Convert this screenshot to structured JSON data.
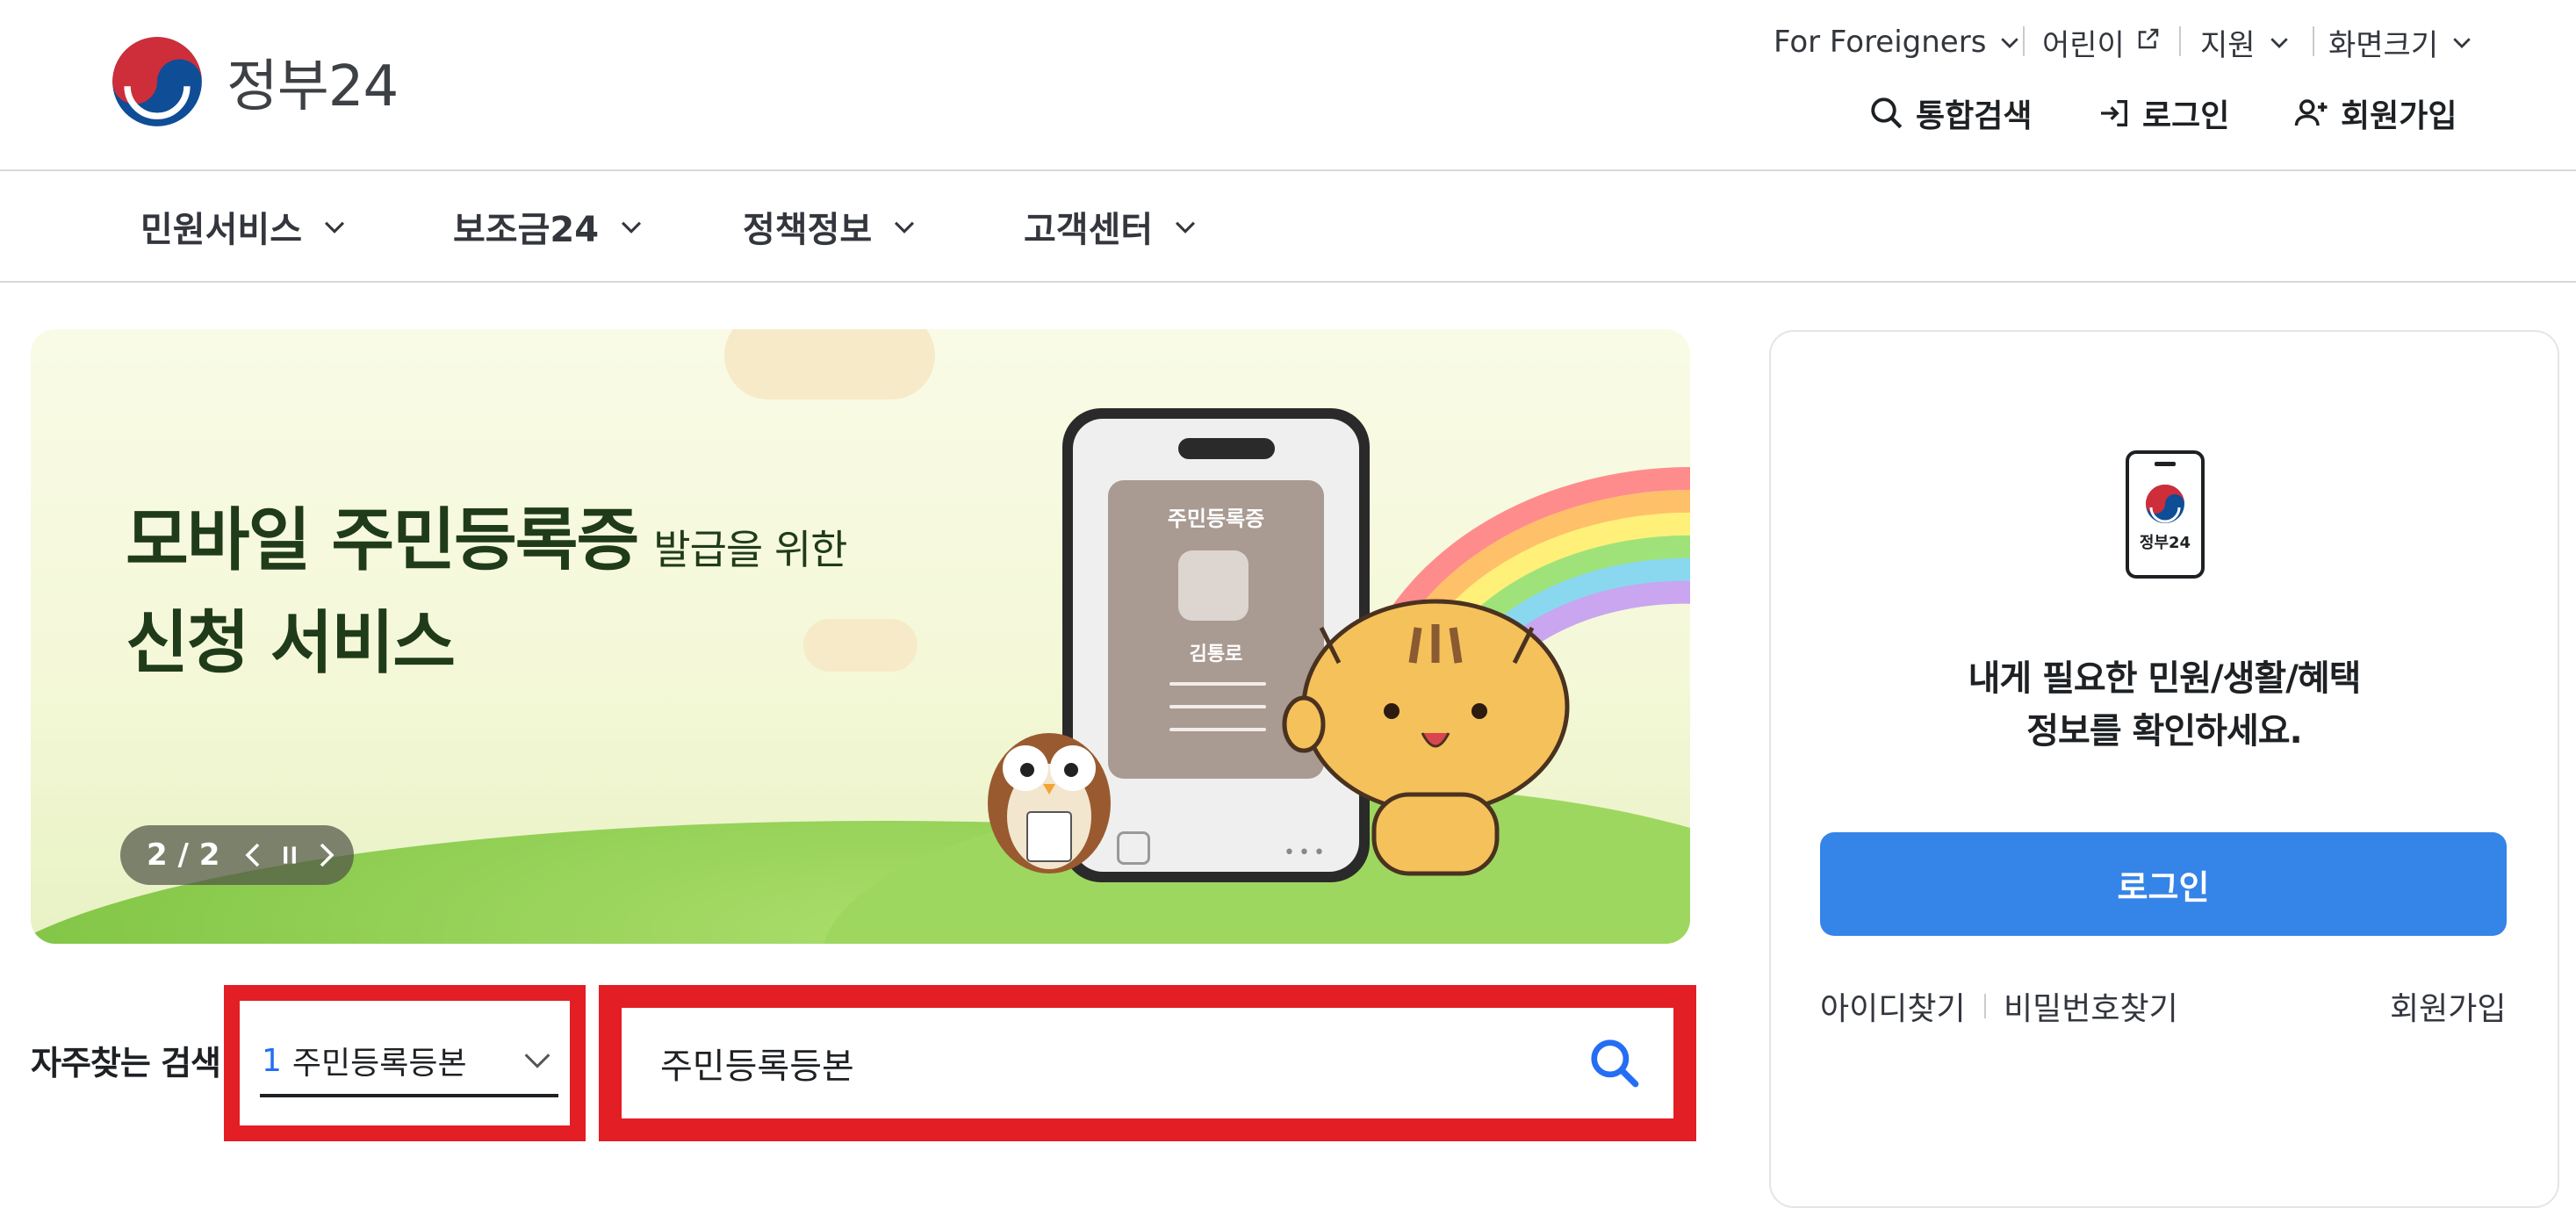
{
  "header": {
    "logo_text": "정부24",
    "util_links": [
      {
        "label": "For Foreigners"
      },
      {
        "label": "어린이"
      },
      {
        "label": "지원"
      },
      {
        "label": "화면크기"
      }
    ],
    "top_buttons": {
      "search": "통합검색",
      "login": "로그인",
      "signup": "회원가입"
    }
  },
  "nav": {
    "items": [
      {
        "label": "민원서비스"
      },
      {
        "label": "보조금24"
      },
      {
        "label": "정책정보"
      },
      {
        "label": "고객센터"
      }
    ]
  },
  "banner": {
    "headline_main": "모바일 주민등록증",
    "headline_small": "발급을 위한",
    "headline_line2": "신청 서비스",
    "card_title": "주민등록증",
    "card_name": "김통로",
    "slide_indicator": "2 / 2"
  },
  "frequent_search": {
    "label": "자주찾는 검색",
    "selected_number": "1",
    "selected_value": "주민등록등본",
    "input_value": "주민등록등본"
  },
  "login_panel": {
    "phone_label": "정부24",
    "message_line1": "내게 필요한 민원/생활/혜택",
    "message_line2": "정보를 확인하세요.",
    "login_button": "로그인",
    "find_id": "아이디찾기",
    "find_password": "비밀번호찾기",
    "signup": "회원가입"
  },
  "colors": {
    "primary_blue": "#3584e8",
    "highlight_red": "#e31e24",
    "text": "#1e2124"
  }
}
